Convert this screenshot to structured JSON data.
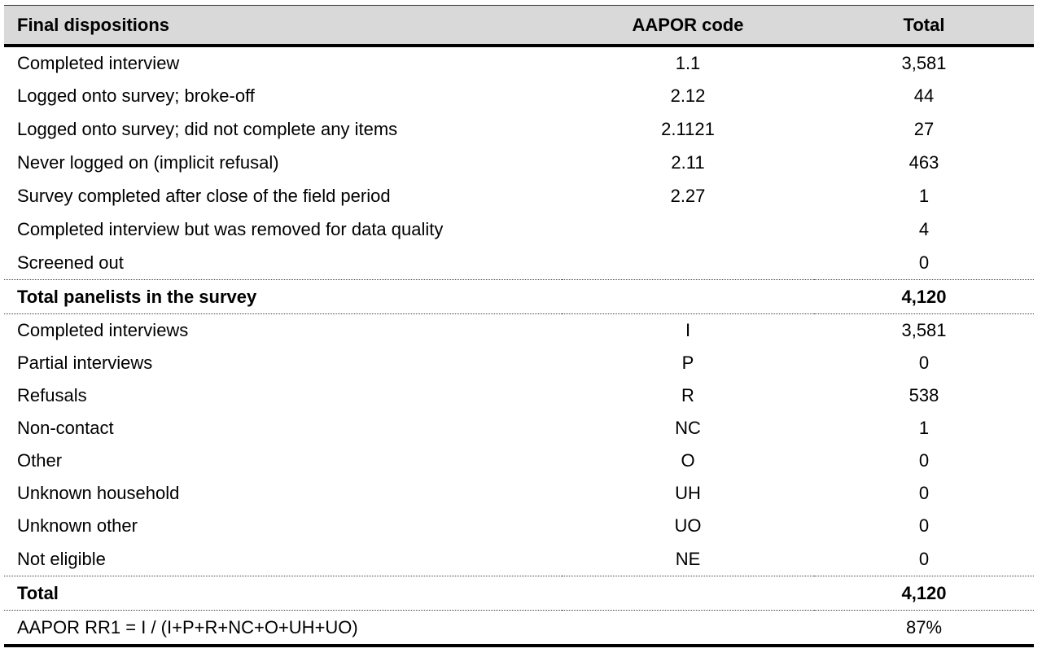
{
  "table": {
    "headers": {
      "disposition": "Final dispositions",
      "code": "AAPOR code",
      "total": "Total"
    },
    "rows": [
      {
        "label": "Completed interview",
        "code": "1.1",
        "total": "3,581",
        "bold": false
      },
      {
        "label": "Logged onto survey; broke-off",
        "code": "2.12",
        "total": "44",
        "bold": false
      },
      {
        "label": "Logged onto survey; did not complete any items",
        "code": "2.1121",
        "total": "27",
        "bold": false
      },
      {
        "label": "Never logged on (implicit refusal)",
        "code": "2.11",
        "total": "463",
        "bold": false
      },
      {
        "label": "Survey completed after close of the field period",
        "code": "2.27",
        "total": "1",
        "bold": false
      },
      {
        "label": "Completed interview but was removed for data quality",
        "code": "",
        "total": "4",
        "bold": false
      },
      {
        "label": "Screened out",
        "code": "",
        "total": "0",
        "bold": false
      },
      {
        "label": "Total panelists in the survey",
        "code": "",
        "total": "4,120",
        "bold": true
      },
      {
        "label": "Completed interviews",
        "code": "I",
        "total": "3,581",
        "bold": false
      },
      {
        "label": "Partial interviews",
        "code": "P",
        "total": "0",
        "bold": false
      },
      {
        "label": "Refusals",
        "code": "R",
        "total": "538",
        "bold": false
      },
      {
        "label": "Non-contact",
        "code": "NC",
        "total": "1",
        "bold": false
      },
      {
        "label": "Other",
        "code": "O",
        "total": "0",
        "bold": false
      },
      {
        "label": "Unknown household",
        "code": "UH",
        "total": "0",
        "bold": false
      },
      {
        "label": "Unknown other",
        "code": "UO",
        "total": "0",
        "bold": false
      },
      {
        "label": "Not eligible",
        "code": "NE",
        "total": "0",
        "bold": false
      },
      {
        "label": "Total",
        "code": "",
        "total": "4,120",
        "bold": true
      },
      {
        "label": "AAPOR RR1 = I / (I+P+R+NC+O+UH+UO)",
        "code": "",
        "total": "87%",
        "bold": false
      }
    ]
  }
}
